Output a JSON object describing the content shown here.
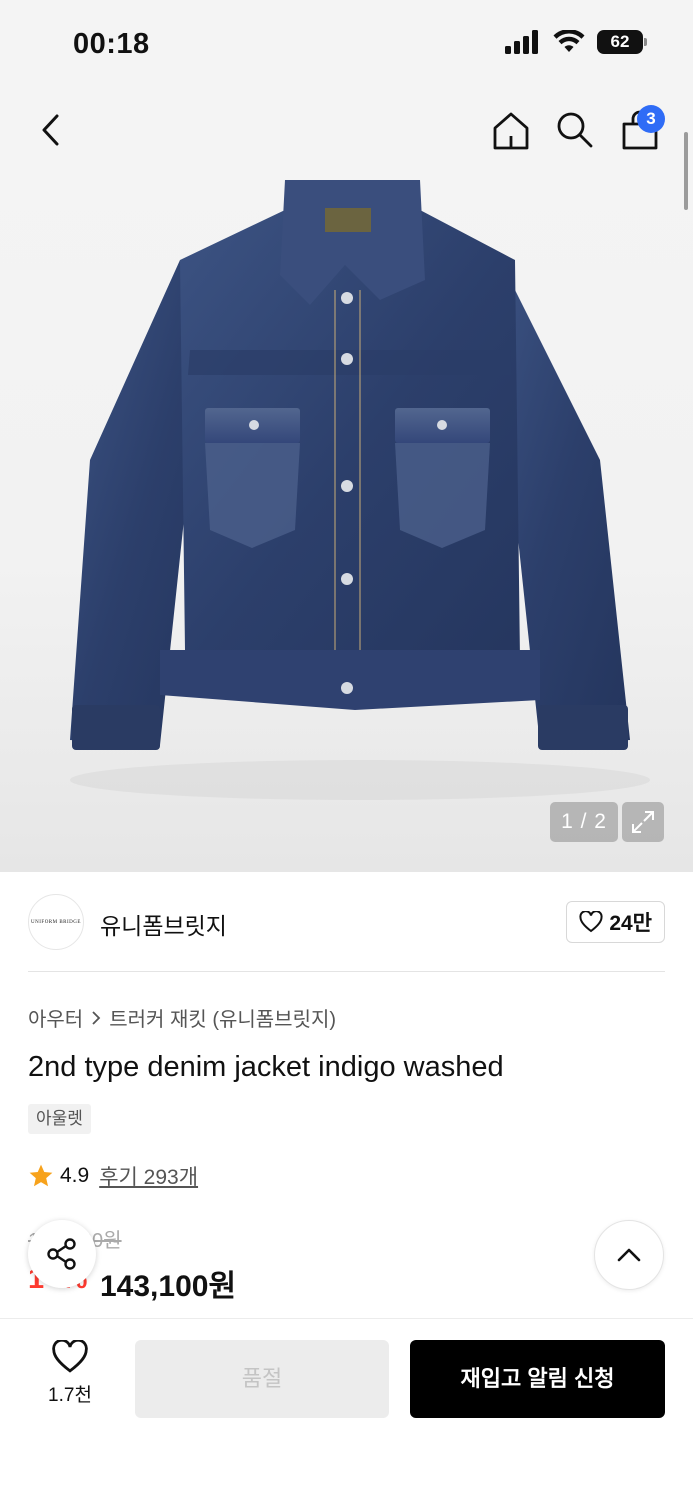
{
  "status_bar": {
    "time": "00:18",
    "battery": "62"
  },
  "header": {
    "back_icon": "chevron-left-icon",
    "home_icon": "home-icon",
    "search_icon": "search-icon",
    "cart_icon": "shopping-bag-icon",
    "cart_count": "3"
  },
  "gallery": {
    "counter": "1 / 2",
    "expand_icon": "expand-icon"
  },
  "brand": {
    "logo_text": "UNIFORM BRIDGE",
    "name": "유니폼브릿지",
    "like_count": "24만"
  },
  "breadcrumb": {
    "category": "아우터",
    "subcategory": "트러커 재킷 (유니폼브릿지)"
  },
  "product": {
    "title": "2nd type denim jacket indigo washed",
    "tag": "아울렛",
    "rating": "4.9",
    "reviews": "후기 293개",
    "original_price": "1●●,●00원",
    "discount": "1●%",
    "sale_price": "143,100원"
  },
  "bottom": {
    "wish_count": "1.7천",
    "soldout_label": "품절",
    "restock_label": "재입고 알림 신청"
  },
  "colors": {
    "accent_blue": "#2f6cf6",
    "discount_red": "#ff3b30",
    "star": "#f7a21b",
    "cta_black": "#000000"
  }
}
